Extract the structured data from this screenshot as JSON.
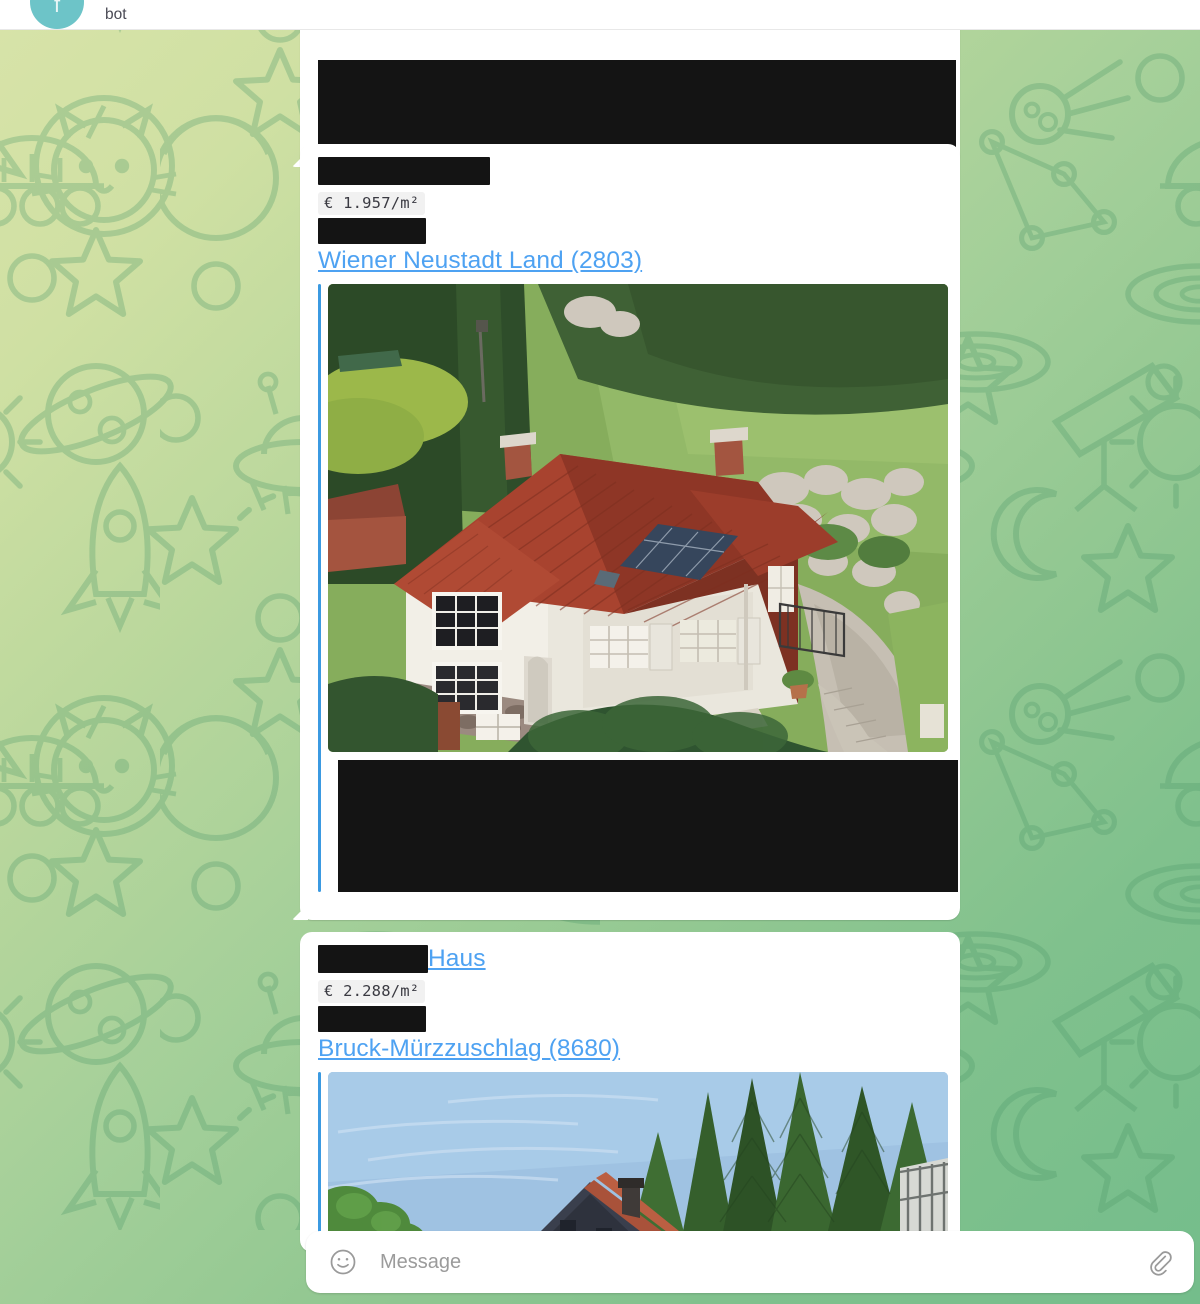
{
  "header": {
    "title": "bot",
    "avatar_letter": "f",
    "avatar_color": "#6dc4c8",
    "avatar_name": "avatar"
  },
  "theme": {
    "link_color": "#4ea2f2",
    "accent_bar_color": "#3b9ae1",
    "bubble_bg": "#ffffff",
    "redaction_color": "#141414",
    "code_bg": "#f1f1f1",
    "wallpaper_from": "#d7e3a8",
    "wallpaper_to": "#74bd8b"
  },
  "messages": [
    {
      "id": "msg-1",
      "redacted": true,
      "note": "redacted text block"
    },
    {
      "id": "msg-2",
      "title_redacted": true,
      "title_suffix": "",
      "price": "€ 1.957/m²",
      "detail_redacted": true,
      "location": "Wiener Neustadt Land (2803)",
      "photo_alt": "aerial-photo-of-house-with-red-tile-roof",
      "footer_redacted": true
    },
    {
      "id": "msg-3",
      "title_redacted": true,
      "title_suffix": "Haus",
      "price": "€ 2.288/m²",
      "detail_redacted": true,
      "location": "Bruck-Mürzzuschlag (8680)",
      "photo_alt": "photo-of-house-roof-with-conifer-trees-and-blue-sky",
      "footer_redacted": false
    }
  ],
  "composer": {
    "placeholder": "Message",
    "value": "",
    "emoji_icon": "smiley-icon",
    "attach_icon": "paperclip-icon"
  }
}
